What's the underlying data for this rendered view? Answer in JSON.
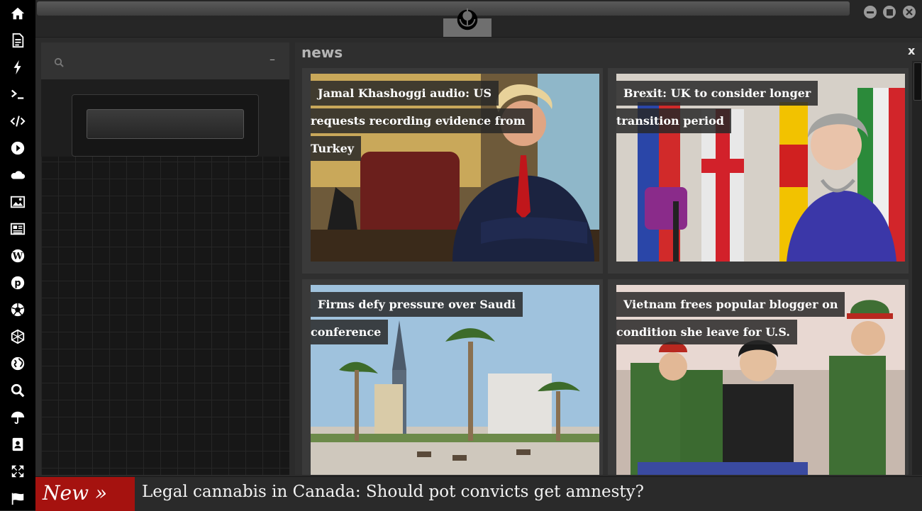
{
  "sidebar": {
    "icons": [
      "home-icon",
      "document-icon",
      "lightning-icon",
      "terminal-icon",
      "code-icon",
      "play-icon",
      "cloud-icon",
      "image-icon",
      "newspaper-icon",
      "wordpress-icon",
      "pinterest-icon",
      "aperture-icon",
      "network-icon",
      "globe-icon",
      "search-icon",
      "umbrella-icon",
      "contacts-icon",
      "expand-icon",
      "flag-icon"
    ]
  },
  "left_panel": {
    "collapse_symbol": "–"
  },
  "news": {
    "title": "news",
    "close": "x",
    "articles": [
      {
        "headline": "Jamal Khashoggi audio: US requests recording evidence from Turkey"
      },
      {
        "headline": "Brexit: UK to consider longer transition period"
      },
      {
        "headline": "Firms defy pressure over Saudi conference"
      },
      {
        "headline": "Vietnam frees popular blogger on condition she leave for U.S."
      }
    ]
  },
  "ticker": {
    "badge": "New »",
    "text": "Legal cannabis in Canada: Should pot convicts get amnesty?"
  },
  "colors": {
    "ticker_badge": "#a5120f",
    "background": "#2b2b2b"
  }
}
